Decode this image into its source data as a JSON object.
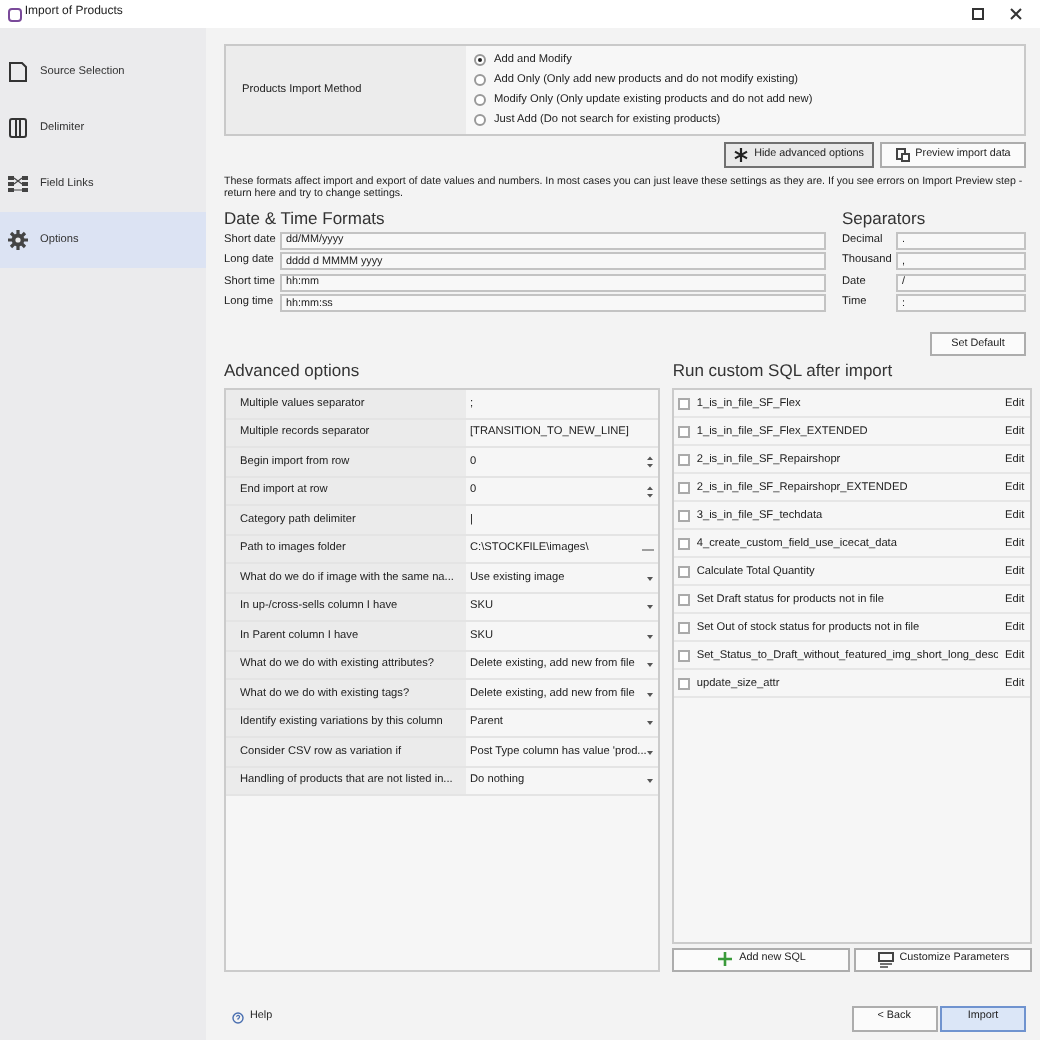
{
  "window": {
    "title": "Import of Products"
  },
  "sidebar": {
    "items": [
      {
        "label": "Source Selection",
        "selected": false
      },
      {
        "label": "Delimiter",
        "selected": false
      },
      {
        "label": "Field Links",
        "selected": false
      },
      {
        "label": "Options",
        "selected": true
      }
    ]
  },
  "import_method": {
    "label": "Products Import Method",
    "options": [
      {
        "label": "Add and Modify",
        "selected": true
      },
      {
        "label": "Add Only (Only add new products and do not modify existing)",
        "selected": false
      },
      {
        "label": "Modify Only (Only update existing products and do not add new)",
        "selected": false
      },
      {
        "label": "Just Add (Do not search for existing products)",
        "selected": false
      }
    ]
  },
  "actions": [
    "Hide advanced options",
    "Preview import data"
  ],
  "info": "These formats affect import and export of date values and numbers. In most cases you can just leave these settings as they are. If you see errors on Import Preview step - return here and try to change settings.",
  "date_time": {
    "title": "Date & Time Formats",
    "fields": [
      {
        "label": "Short date",
        "value": "dd/MM/yyyy"
      },
      {
        "label": "Long date",
        "value": "dddd d MMMM yyyy"
      },
      {
        "label": "Short time",
        "value": "hh:mm"
      },
      {
        "label": "Long time",
        "value": "hh:mm:ss"
      }
    ]
  },
  "separators": {
    "title": "Separators",
    "fields": [
      {
        "label": "Decimal",
        "value": "."
      },
      {
        "label": "Thousand",
        "value": ","
      },
      {
        "label": "Date",
        "value": "/"
      },
      {
        "label": "Time",
        "value": ":"
      }
    ]
  },
  "set_default": "Set Default",
  "advanced": {
    "title": "Advanced options",
    "rows": [
      {
        "label": "Multiple values separator",
        "value": ";",
        "kind": "text"
      },
      {
        "label": "Multiple records separator",
        "value": "[TRANSITION_TO_NEW_LINE]",
        "kind": "text"
      },
      {
        "label": "Begin import from row",
        "value": "0",
        "kind": "spin"
      },
      {
        "label": "End import at row",
        "value": "0",
        "kind": "spin"
      },
      {
        "label": "Category path delimiter",
        "value": "|",
        "kind": "text"
      },
      {
        "label": "Path to images folder",
        "value": "C:\\STOCKFILE\\images\\",
        "kind": "browse"
      },
      {
        "label": "What do we do if image with the same na...",
        "value": "Use existing image",
        "kind": "dropdown"
      },
      {
        "label": "In up-/cross-sells column I have",
        "value": "SKU",
        "kind": "dropdown"
      },
      {
        "label": "In Parent column I have",
        "value": "SKU",
        "kind": "dropdown"
      },
      {
        "label": "What do we do with existing attributes?",
        "value": "Delete existing, add new from file",
        "kind": "dropdown"
      },
      {
        "label": "What do we do with existing tags?",
        "value": "Delete existing, add new from file",
        "kind": "dropdown"
      },
      {
        "label": "Identify existing variations by this column",
        "value": "Parent",
        "kind": "dropdown"
      },
      {
        "label": "Consider CSV row as variation if",
        "value": "Post Type column has value 'prod...",
        "kind": "dropdown"
      },
      {
        "label": "Handling of products that are not listed in...",
        "value": "Do nothing",
        "kind": "dropdown"
      }
    ]
  },
  "sql": {
    "title": "Run custom SQL after import",
    "items": [
      {
        "label": "1_is_in_file_SF_Flex",
        "checked": false,
        "action": "Edit"
      },
      {
        "label": "1_is_in_file_SF_Flex_EXTENDED",
        "checked": false,
        "action": "Edit"
      },
      {
        "label": "2_is_in_file_SF_Repairshopr",
        "checked": false,
        "action": "Edit"
      },
      {
        "label": "2_is_in_file_SF_Repairshopr_EXTENDED",
        "checked": false,
        "action": "Edit"
      },
      {
        "label": "3_is_in_file_SF_techdata",
        "checked": false,
        "action": "Edit"
      },
      {
        "label": "4_create_custom_field_use_icecat_data",
        "checked": false,
        "action": "Edit"
      },
      {
        "label": "Calculate Total Quantity",
        "checked": false,
        "action": "Edit"
      },
      {
        "label": "Set Draft status for products not in file",
        "checked": false,
        "action": "Edit"
      },
      {
        "label": "Set Out of stock status for products not in file",
        "checked": false,
        "action": "Edit"
      },
      {
        "label": "Set_Status_to_Draft_without_featured_img_short_long_desc",
        "checked": false,
        "action": "Edit"
      },
      {
        "label": "update_size_attr",
        "checked": false,
        "action": "Edit"
      }
    ],
    "buttons": [
      "Add new SQL",
      "Customize Parameters"
    ]
  },
  "footer": {
    "help": "Help",
    "back": "< Back",
    "import": "Import"
  }
}
